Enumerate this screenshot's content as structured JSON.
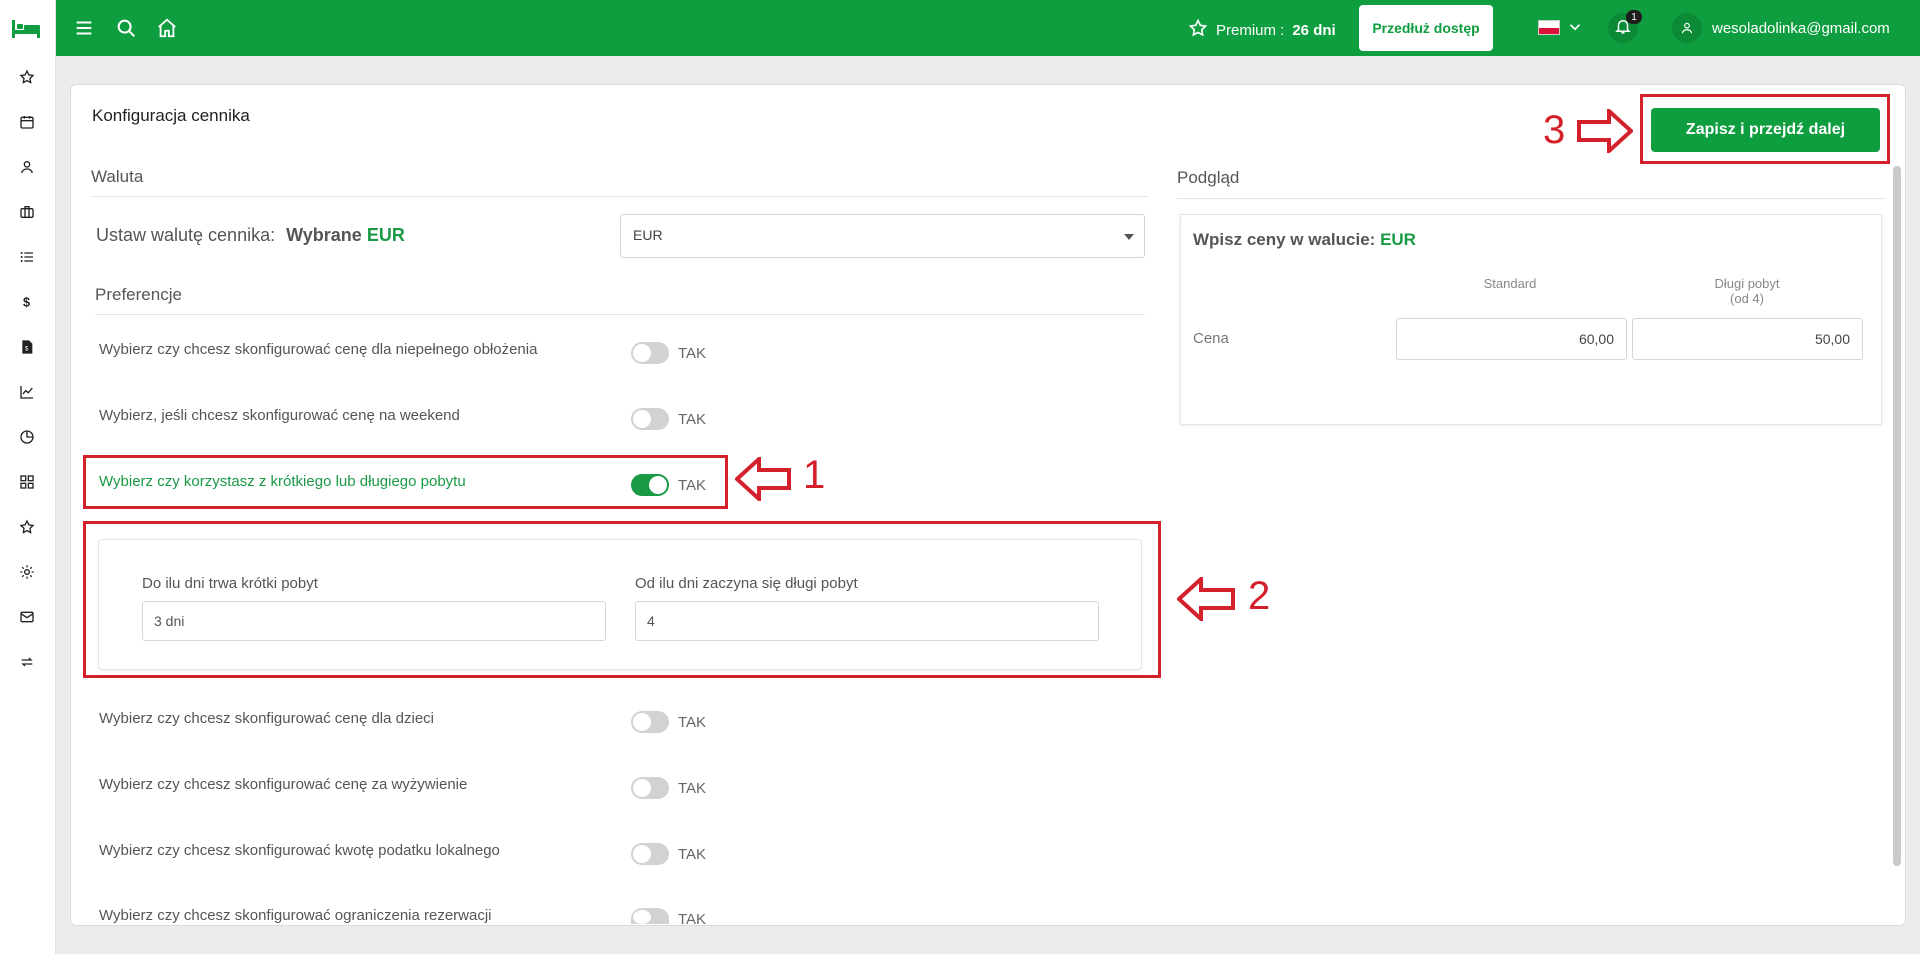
{
  "topbar": {
    "premium_label": "Premium : ",
    "premium_days": "26 dni",
    "extend_button": "Przedłuż dostęp",
    "notification_count": "1",
    "user_email": "wesoladolinka@gmail.com"
  },
  "sidebar": {
    "icons": [
      "bed-logo-icon",
      "star-icon",
      "calendar-icon",
      "user-icon",
      "briefcase-icon",
      "list-icon",
      "dollar-icon",
      "document-icon",
      "chart-line-icon",
      "pie-chart-icon",
      "grid-icon",
      "star-icon",
      "gear-icon",
      "mail-icon",
      "sync-icon"
    ]
  },
  "page": {
    "title": "Konfiguracja cennika",
    "save_button": "Zapisz i przejdź dalej"
  },
  "currency": {
    "section_title": "Waluta",
    "label": "Ustaw walutę cennika:",
    "selected_prefix": "Wybrane",
    "selected_value": "EUR",
    "select_value": "EUR"
  },
  "preferences": {
    "section_title": "Preferencje",
    "toggle_label": "TAK",
    "rows": [
      {
        "label": "Wybierz czy chcesz skonfigurować cenę dla niepełnego obłożenia",
        "on": false
      },
      {
        "label": "Wybierz, jeśli chcesz skonfigurować cenę na weekend",
        "on": false
      },
      {
        "label": "Wybierz czy korzystasz z krótkiego lub długiego pobytu",
        "on": true
      },
      {
        "label": "Wybierz czy chcesz skonfigurować cenę dla dzieci",
        "on": false
      },
      {
        "label": "Wybierz czy chcesz skonfigurować cenę za wyżywienie",
        "on": false
      },
      {
        "label": "Wybierz czy chcesz skonfigurować kwotę podatku lokalnego",
        "on": false
      },
      {
        "label": "Wybierz czy chcesz skonfigurować ograniczenia rezerwacji",
        "on": false
      }
    ],
    "stay": {
      "short_label": "Do ilu dni trwa krótki pobyt",
      "short_value": "3 dni",
      "long_label": "Od ilu dni zaczyna się długi pobyt",
      "long_value": "4"
    }
  },
  "preview": {
    "section_title": "Podgląd",
    "prompt": "Wpisz ceny w walucie:",
    "currency": "EUR",
    "col_standard": "Standard",
    "col_long": "Długi pobyt",
    "col_long_sub": "(od 4)",
    "row_label": "Cena",
    "standard_price": "60,00",
    "long_price": "50,00"
  },
  "annotations": {
    "n1": "1",
    "n2": "2",
    "n3": "3",
    "color": "#d4202a"
  },
  "colors": {
    "brand": "#0f9e3f",
    "accent_text": "#1a9a45"
  }
}
